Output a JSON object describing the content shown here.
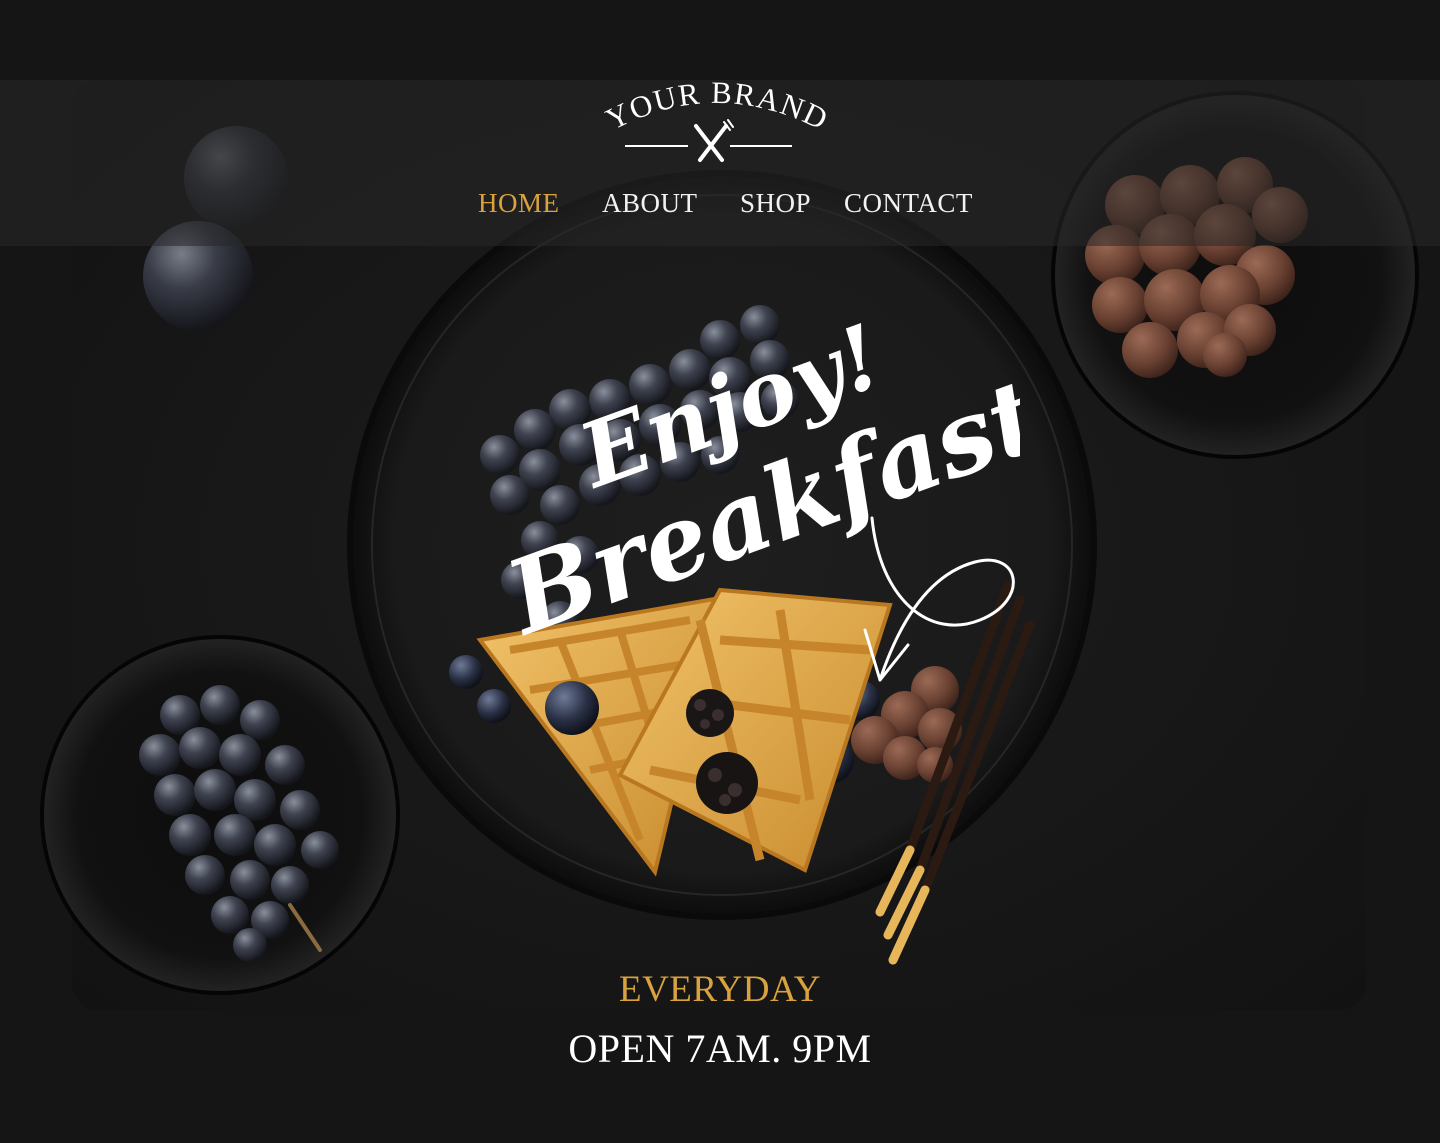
{
  "brand": {
    "name": "YOUR BRAND",
    "logo_icon": "fork-knife-icon"
  },
  "nav": {
    "items": [
      {
        "label": "HOME",
        "active": true
      },
      {
        "label": "ABOUT",
        "active": false
      },
      {
        "label": "SHOP",
        "active": false
      },
      {
        "label": "CONTACT",
        "active": false
      }
    ]
  },
  "hero": {
    "line1": "Enjoy!",
    "line2": "Breakfast"
  },
  "footer": {
    "tagline": "EVERYDAY",
    "hours": "OPEN 7AM. 9PM"
  },
  "colors": {
    "accent": "#d9a23e",
    "text": "#ffffff",
    "background": "#151515"
  }
}
